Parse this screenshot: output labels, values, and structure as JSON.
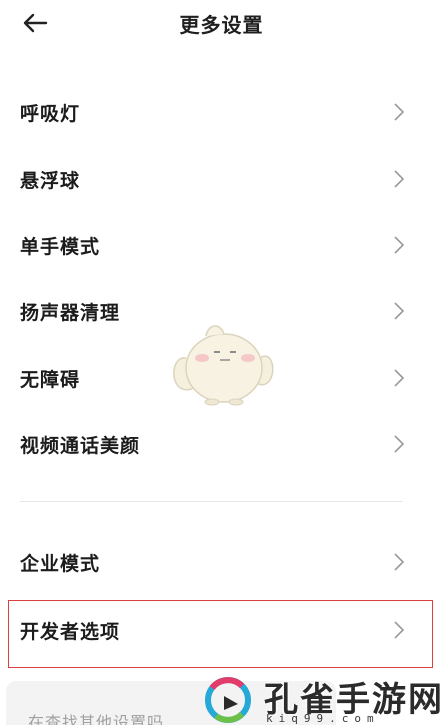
{
  "header": {
    "title": "更多设置",
    "back_icon": "arrow-left-icon"
  },
  "settings": {
    "group1": [
      {
        "label": "呼吸灯",
        "name": "breathing-light"
      },
      {
        "label": "悬浮球",
        "name": "floating-ball"
      },
      {
        "label": "单手模式",
        "name": "one-hand-mode"
      },
      {
        "label": "扬声器清理",
        "name": "speaker-cleanup"
      },
      {
        "label": "无障碍",
        "name": "accessibility"
      },
      {
        "label": "视频通话美颜",
        "name": "video-call-beauty"
      }
    ],
    "group2": [
      {
        "label": "企业模式",
        "name": "enterprise-mode"
      },
      {
        "label": "开发者选项",
        "name": "developer-options"
      }
    ]
  },
  "search_hint": {
    "text": "在查找其他设置吗"
  },
  "watermark": {
    "text": "孔雀手游网",
    "url": "kiq99.com"
  },
  "colors": {
    "highlight_border": "#d94040",
    "chevron": "#9a9a9a",
    "hint_bg": "#f3f3f3"
  }
}
